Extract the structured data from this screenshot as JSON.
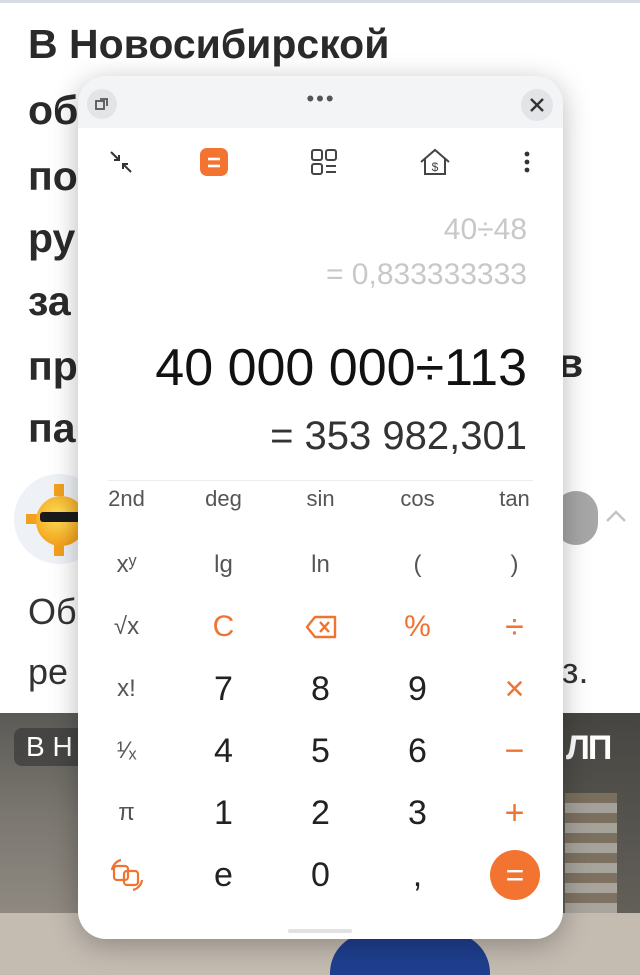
{
  "article": {
    "headline_lines": [
      "В Новосибирской",
      "об",
      "по",
      "ру",
      "за",
      "пр",
      "па"
    ],
    "headline_right_fragment": "в",
    "body_lines": [
      "Об",
      "ре"
    ],
    "body_right_fragment": "з.",
    "video_badge": "В Н",
    "video_logo": "ЛП"
  },
  "calculator": {
    "display": {
      "history_expression": "40÷48",
      "history_result": "= 0,833333333",
      "main_expression": "40 000 000÷113",
      "main_result": "= 353 982,301"
    },
    "scientific_row": [
      "2nd",
      "deg",
      "sin",
      "cos",
      "tan"
    ],
    "keys": {
      "xy": "xʸ",
      "lg": "lg",
      "ln": "ln",
      "lparen": "(",
      "rparen": ")",
      "sqrt": "√x",
      "clear": "C",
      "percent": "%",
      "divide": "÷",
      "fact": "x!",
      "seven": "7",
      "eight": "8",
      "nine": "9",
      "multiply": "×",
      "recip": "¹⁄ₓ",
      "four": "4",
      "five": "5",
      "six": "6",
      "minus": "−",
      "pi": "π",
      "one": "1",
      "two": "2",
      "three": "3",
      "plus": "+",
      "e": "e",
      "zero": "0",
      "comma": ",",
      "equals": "="
    },
    "icons": {
      "accent_color": "#f27430",
      "toolbar": [
        "collapse-icon",
        "calculator-mode-icon",
        "converter-icon",
        "currency-icon",
        "more-icon"
      ]
    }
  }
}
